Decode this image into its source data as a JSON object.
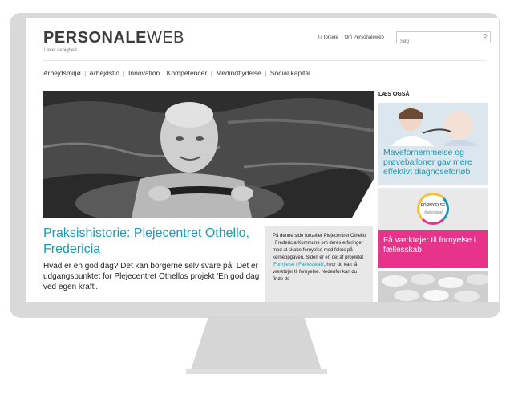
{
  "site": {
    "logo_bold": "PERSONALE",
    "logo_light": "WEB",
    "tagline": "Lavet i enighed"
  },
  "top_links": [
    "Til forside",
    "Om Personaleweb"
  ],
  "search": {
    "placeholder": "Søg",
    "icon": "search-icon"
  },
  "nav": {
    "items": [
      "Arbejdsmiljø",
      "Arbejdstid",
      "Innovation",
      "Kompetencer",
      "Medindflydelse",
      "Social kapital"
    ],
    "separator": "|"
  },
  "article": {
    "title": "Praksishistorie: Plejecentret Othello, Fredericia",
    "intro": "Hvad er en god dag? Det kan borgerne selv svare på. Det er udgangspunktet for Plejecentret Othellos projekt 'En god dag ved egen kraft'."
  },
  "sidebox": {
    "text_before": "På denne side fortæller Plejecentret Othello i Fredericia Kommune om deres erfaringer med at skabe fornyelse med fokus på kerneopgaven. Siden er en del af projektet '",
    "link": "Fornyelse i Fællesskab",
    "text_after": "', hvor du kan få værktøjer til fornyelse. Nedenfor kan du finde de"
  },
  "sidebar": {
    "heading": "LÆS OGSÅ",
    "card1_caption": "Mavefornemmelse og prøveballoner gav mere effektivt diagnoseforløb",
    "card2_badge_line1": "FORNYELSE",
    "card2_badge_line2": "i fællesskab",
    "card2_caption": "Få værktøjer til fornyelse i fællesskab"
  },
  "colors": {
    "accent": "#1a9ab0",
    "pink": "#e8338a"
  }
}
